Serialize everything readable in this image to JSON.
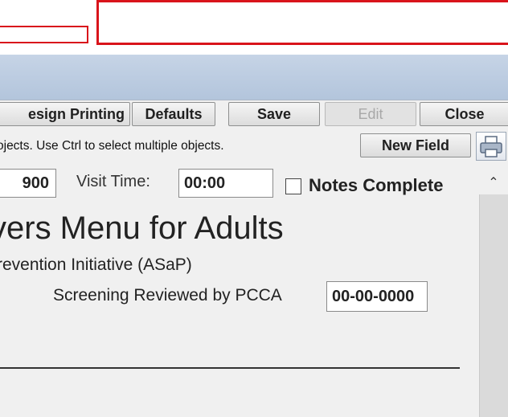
{
  "toolbar": {
    "design_printing_label": "esign Printing",
    "defaults_label": "Defaults",
    "save_label": "Save",
    "edit_label": "Edit",
    "close_label": "Close",
    "new_field_label": "New Field",
    "hint_text": "ojects.  Use Ctrl to select multiple objects."
  },
  "form": {
    "visit_date_value": "900",
    "visit_time_label": "Visit Time:",
    "visit_time_value": "00:00",
    "notes_complete_label": "Notes Complete",
    "title": "vers Menu for Adults",
    "initiative": "revention Initiative (ASaP)",
    "reviewed_label": "Screening Reviewed by PCCA",
    "reviewed_value": "00-00-0000"
  },
  "icons": {
    "printer": "printer-icon",
    "scroll_up": "chevron-up-icon"
  },
  "colors": {
    "alert_border": "#d9141b",
    "header_band": "#c6d4e6"
  }
}
